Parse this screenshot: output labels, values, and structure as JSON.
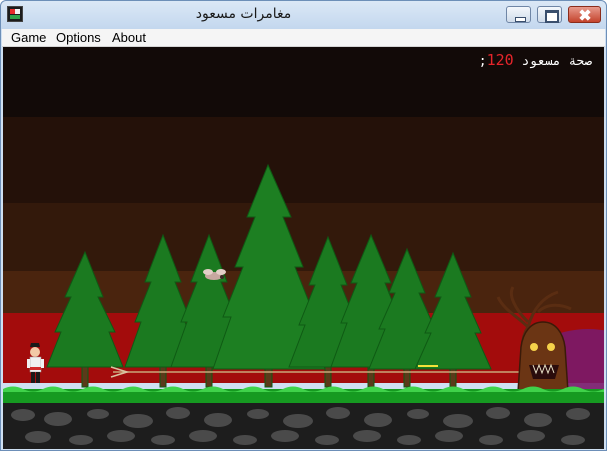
{
  "window": {
    "title": "مغامرات مسعود",
    "controls": [
      "minimize",
      "maximize",
      "close"
    ]
  },
  "menu": {
    "items": [
      "Game",
      "Options",
      "About"
    ]
  },
  "hud": {
    "health_label": "صحة مسعود",
    "health_value": "120",
    "separator": ";"
  },
  "colors": {
    "sky_bands": [
      "#120a08",
      "#231009",
      "#33190b",
      "#4a240e",
      "#5b2b10",
      "#a50d0d"
    ],
    "grass": "#169a21",
    "tree": "#1a7a1f",
    "enemy_tree": "#5b2d12",
    "magenta_glow": "#8b1a6f"
  },
  "entities": {
    "player": "player-sprite",
    "enemy": "evil-tree-sprite",
    "flying": "flying-creature-sprite"
  }
}
